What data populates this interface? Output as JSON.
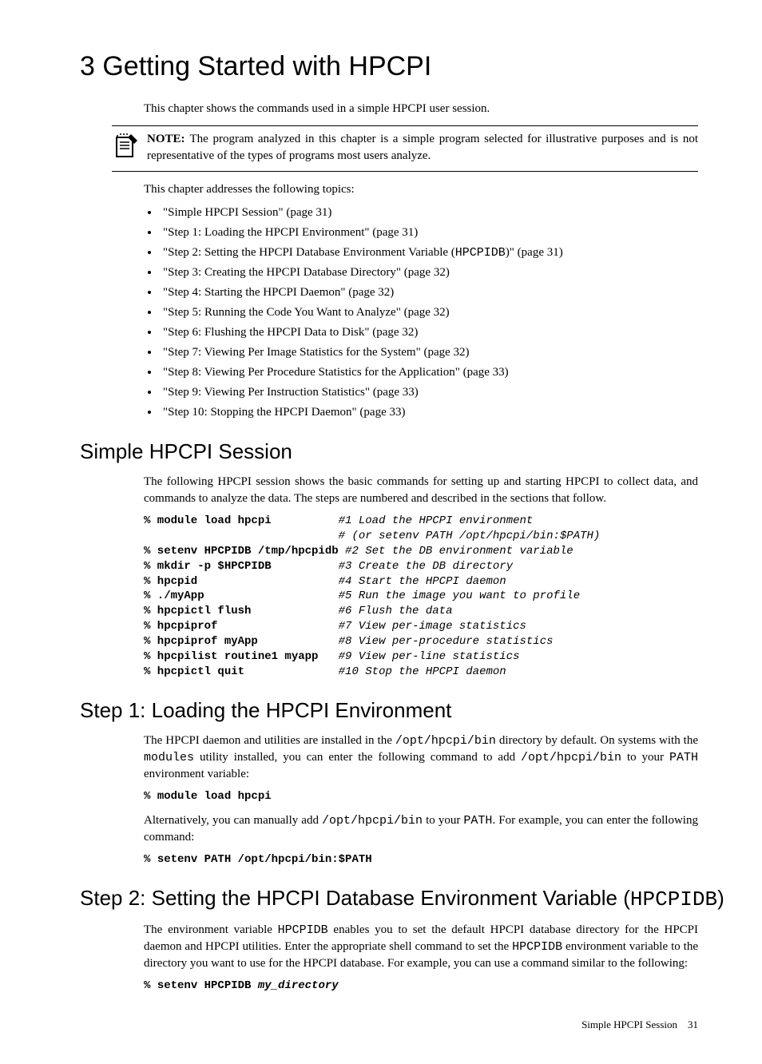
{
  "chapter": {
    "title": "3 Getting Started with HPCPI"
  },
  "intro": "This chapter shows the commands used in a simple HPCPI user session.",
  "note": {
    "label": "NOTE:",
    "text": "The program analyzed in this chapter is a simple program selected for illustrative purposes and is not representative of the types of programs most users analyze."
  },
  "toc_lead": "This chapter addresses the following topics:",
  "toc": [
    "\"Simple HPCPI Session\" (page 31)",
    "\"Step 1: Loading the HPCPI Environment\" (page 31)",
    "\"Step 3: Creating the HPCPI Database Directory\" (page 32)",
    "\"Step 4: Starting the HPCPI Daemon\" (page 32)",
    "\"Step 5: Running the Code You Want to Analyze\" (page 32)",
    "\"Step 6: Flushing the HPCPI Data to Disk\" (page 32)",
    "\"Step 7: Viewing Per Image Statistics for the System\" (page 32)",
    "\"Step 8: Viewing Per Procedure Statistics for the Application\" (page 33)",
    "\"Step 9: Viewing Per Instruction Statistics\" (page 33)",
    "\"Step 10: Stopping the HPCPI Daemon\" (page 33)"
  ],
  "toc_step2": {
    "pre": "\"Step 2: Setting the HPCPI Database Environment Variable (",
    "code": "HPCPIDB",
    "post": ")\" (page 31)"
  },
  "session": {
    "title": "Simple HPCPI Session",
    "para": "The following HPCPI session shows the basic commands for setting up and starting HPCPI to collect data, and commands to analyze the data. The steps are numbered and described in the sections that follow.",
    "rows": [
      {
        "p": "% ",
        "cmd": "module load hpcpi",
        "pad": "          ",
        "cmt": "#1 Load the HPCPI environment"
      },
      {
        "p": "  ",
        "cmd": "",
        "pad": "                           ",
        "cmt": "# (or setenv PATH /opt/hpcpi/bin:$PATH)"
      },
      {
        "p": "% ",
        "cmd": "setenv HPCPIDB /tmp/hpcpidb",
        "pad": " ",
        "cmt": "#2 Set the DB environment variable"
      },
      {
        "p": "% ",
        "cmd": "mkdir -p $HPCPIDB",
        "pad": "          ",
        "cmt": "#3 Create the DB directory"
      },
      {
        "p": "% ",
        "cmd": "hpcpid",
        "pad": "                     ",
        "cmt": "#4 Start the HPCPI daemon"
      },
      {
        "p": "% ",
        "cmd": "./myApp",
        "pad": "                    ",
        "cmt": "#5 Run the image you want to profile"
      },
      {
        "p": "% ",
        "cmd": "hpcpictl flush",
        "pad": "             ",
        "cmt": "#6 Flush the data"
      },
      {
        "p": "% ",
        "cmd": "hpcpiprof",
        "pad": "                  ",
        "cmt": "#7 View per-image statistics"
      },
      {
        "p": "% ",
        "cmd": "hpcpiprof myApp",
        "pad": "            ",
        "cmt": "#8 View per-procedure statistics"
      },
      {
        "p": "% ",
        "cmd": "hpcpilist routine1 myapp",
        "pad": "   ",
        "cmt": "#9 View per-line statistics"
      },
      {
        "p": "% ",
        "cmd": "hpcpictl quit",
        "pad": "              ",
        "cmt": "#10 Stop the HPCPI daemon"
      }
    ]
  },
  "step1": {
    "title": "Step 1: Loading the HPCPI Environment",
    "p1a": "The HPCPI daemon and utilities are installed in the ",
    "c1": "/opt/hpcpi/bin",
    "p1b": " directory by default. On systems with the ",
    "c2": "modules",
    "p1c": " utility installed, you can enter the following command to add ",
    "c3": "/opt/hpcpi/bin",
    "p1d": " to your ",
    "c4": "PATH",
    "p1e": " environment variable:",
    "cmd1": "module load hpcpi",
    "p2a": "Alternatively, you can manually add ",
    "c5": "/opt/hpcpi/bin",
    "p2b": " to your ",
    "c6": "PATH",
    "p2c": ". For example, you can enter the following command:",
    "cmd2": "setenv PATH /opt/hpcpi/bin:$PATH"
  },
  "step2": {
    "title_a": "Step 2: Setting the HPCPI Database Environment Variable (",
    "title_code": "HPCPIDB",
    "title_b": ")",
    "p1a": "The environment variable ",
    "c1": "HPCPIDB",
    "p1b": " enables you to set the default HPCPI database directory for the HPCPI daemon and HPCPI utilities. Enter the appropriate shell command to set the ",
    "c2": "HPCPIDB",
    "p1c": " environment variable to the directory you want to use for the HPCPI database. For example, you can use a command similar to the following:",
    "cmd_pre": "setenv HPCPIDB ",
    "cmd_arg": "my_directory"
  },
  "footer": {
    "section": "Simple HPCPI Session",
    "page": "31"
  },
  "prompt": "% "
}
